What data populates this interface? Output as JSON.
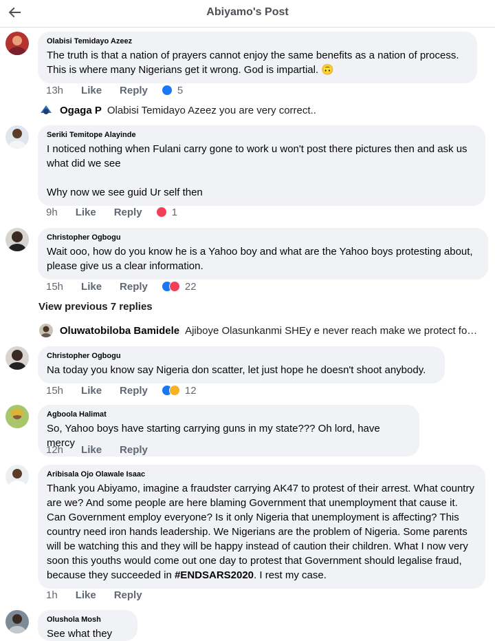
{
  "header": {
    "title": "Abiyamo's Post",
    "back_icon": "arrow-left-icon"
  },
  "comments": [
    {
      "author": "Olabisi Temidayo Azeez",
      "text": "The truth is that a nation of prayers cannot enjoy the same benefits as a nation of process. This is where many Nigerians get it wrong. God is impartial. 🙃",
      "time": "13h",
      "like": "Like",
      "reply": "Reply",
      "reactions": [
        "like"
      ],
      "count": "5"
    },
    {
      "author": "Seriki Temitope Alayinde",
      "text": "I noticed nothing when Fulani carry gone to work u won't post there pictures then and ask us what did we see\n\nWhy now we see guid Ur self then",
      "time": "9h",
      "like": "Like",
      "reply": "Reply",
      "reactions": [
        "love"
      ],
      "count": "1"
    },
    {
      "author": "Christopher Ogbogu",
      "text": "Wait ooo, how do you know he is a Yahoo boy and what are the Yahoo boys protesting about, please give us a clear information.",
      "time": "15h",
      "like": "Like",
      "reply": "Reply",
      "reactions": [
        "like",
        "love"
      ],
      "count": "22"
    },
    {
      "author": "Christopher Ogbogu",
      "text": "Na today you know say Nigeria don scatter, let just hope he doesn't shoot anybody.",
      "time": "15h",
      "like": "Like",
      "reply": "Reply",
      "reactions": [
        "like",
        "haha"
      ],
      "count": "12"
    },
    {
      "author": "Agboola Halimat",
      "text": "So, Yahoo boys have starting carrying guns in my state??? Oh lord, have mercy",
      "time": "12h",
      "like": "Like",
      "reply": "Reply",
      "reactions": [],
      "count": ""
    },
    {
      "author": "Aribisala Ojo Olawale Isaac",
      "text_before": "Thank you Abiyamo, imagine a fraudster carrying AK47 to protest of their arrest. What country are we? And some people are here blaming Government that unemployment that cause it. Can Government employ everyone? Is it only Nigeria that unemployment is affecting? This country need iron hands leadership. We Nigerians are the problem of Nigeria. Some parents will be watching this and they will be happy instead of caution their children. What I now very soon this youths would come out one day to protest that Government should legalise fraud, because they succeeded in ",
      "hashtag": "#ENDSARS2020",
      "text_after": ". I rest my case.",
      "time": "1h",
      "like": "Like",
      "reply": "Reply",
      "reactions": [],
      "count": ""
    },
    {
      "author": "Olushola Mosh",
      "text": "See what they did",
      "time": "",
      "like": "",
      "reply": "",
      "reactions": [],
      "count": ""
    }
  ],
  "replies": [
    {
      "name": "Ogaga P",
      "text": "Olabisi Temidayo Azeez you are very correct.."
    },
    {
      "name": "Oluwatobiloba Bamidele",
      "text": "Ajiboye Olasunkanmi SHEy e never reach make we protect for…"
    }
  ],
  "view_previous": "View previous 7 replies",
  "colors": {
    "like_blue": "#1877f2",
    "love_red": "#f33e58",
    "haha_yellow": "#f7b125",
    "bubble": "#f0f2f5",
    "meta_gray": "#65676b"
  }
}
